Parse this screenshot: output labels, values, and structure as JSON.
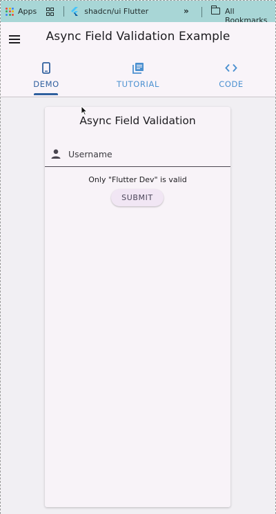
{
  "browser": {
    "bookmarks": {
      "apps_label": "Apps",
      "bookmark_1": "shadcn/ui Flutter",
      "overflow": "»",
      "all_bookmarks": "All Bookmarks"
    }
  },
  "appbar": {
    "title": "Async Field Validation Example",
    "tabs": [
      {
        "label": "DEMO",
        "icon": "phone-icon",
        "active": true
      },
      {
        "label": "TUTORIAL",
        "icon": "article-icon",
        "active": false
      },
      {
        "label": "CODE",
        "icon": "code-icon",
        "active": false
      }
    ]
  },
  "card": {
    "title": "Async Field Validation",
    "username_label": "Username",
    "helper_text": "Only \"Flutter Dev\" is valid",
    "submit_label": "SUBMIT"
  },
  "colors": {
    "bookmarks_bar": "#a8d6d6",
    "accent_active": "#2f5f9e",
    "accent_inactive": "#4a90d0",
    "surface": "#f8f3f8"
  }
}
